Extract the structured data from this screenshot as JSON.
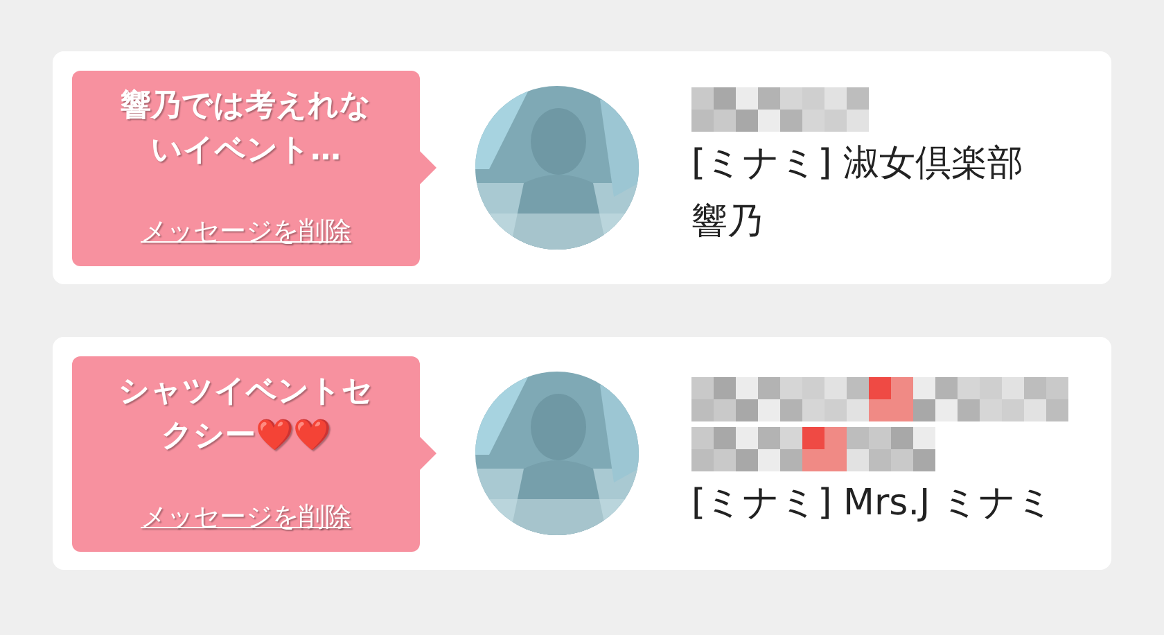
{
  "messages": [
    {
      "bubble_text": "響乃では考えれないイベント…",
      "delete_link": "メッセージを削除",
      "blurred_lines": [
        {
          "accent": false
        }
      ],
      "name_lines": [
        "[ミナミ] 淑女倶楽部",
        "響乃"
      ]
    },
    {
      "bubble_text": "シャツイベントセクシー❤️❤️",
      "delete_link": "メッセージを削除",
      "blurred_lines": [
        {
          "accent": true
        },
        {
          "accent": true
        }
      ],
      "name_lines": [
        "[ミナミ] Mrs.J ミナミ"
      ]
    }
  ]
}
